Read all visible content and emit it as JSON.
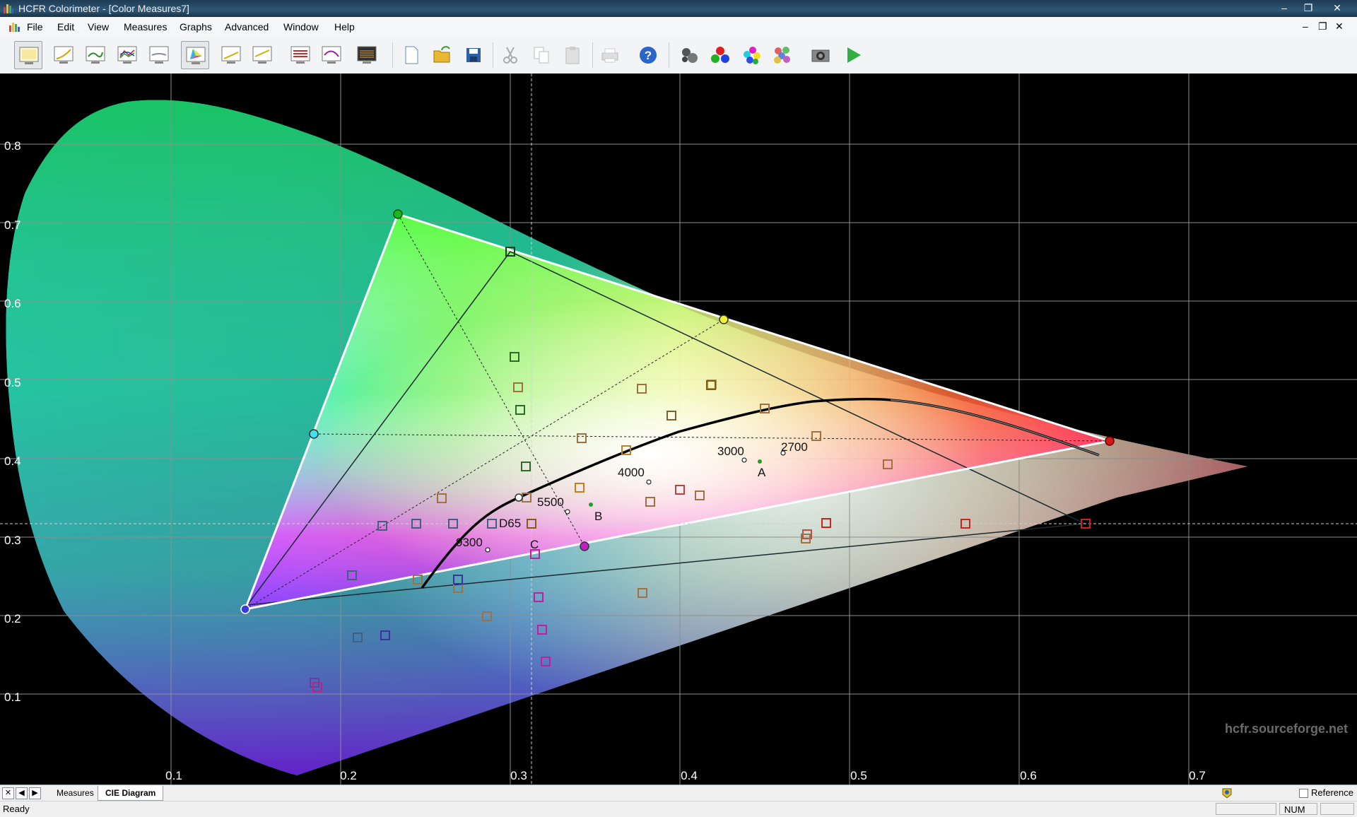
{
  "window": {
    "title": "HCFR Colorimeter - [Color Measures7]"
  },
  "menu": [
    "File",
    "Edit",
    "View",
    "Measures",
    "Graphs",
    "Advanced",
    "Window",
    "Help"
  ],
  "toolbar_icons": [
    "measures-view-icon",
    "gamma-graph-icon",
    "luminance-graph-icon",
    "rgb-levels-graph-icon",
    "color-temp-graph-icon",
    "cie-diagram-icon",
    "near-black-graph-icon",
    "near-white-graph-icon",
    "saturation-graph-icon",
    "saturation-shift-graph-icon",
    "measures-comparison-icon",
    "new-document-icon",
    "open-folder-icon",
    "save-icon",
    "cut-icon",
    "copy-icon",
    "paste-icon",
    "print-icon",
    "help-icon",
    "sensor-icon",
    "primaries-icon",
    "secondaries-icon",
    "color-checker-icon",
    "camera-icon",
    "run-sequence-icon"
  ],
  "axes": {
    "x_ticks": [
      "0.1",
      "0.2",
      "0.3",
      "0.4",
      "0.5",
      "0.6",
      "0.7"
    ],
    "y_ticks": [
      "0.1",
      "0.2",
      "0.3",
      "0.4",
      "0.5",
      "0.6",
      "0.7",
      "0.8"
    ]
  },
  "labels": {
    "cct": [
      "9300",
      "5500",
      "4000",
      "3000",
      "2700"
    ],
    "white_points": [
      "D65",
      "C",
      "B",
      "A"
    ],
    "watermark": "hcfr.sourceforge.net"
  },
  "tabs": {
    "measures": "Measures",
    "cie": "CIE Diagram"
  },
  "reference_label": "Reference",
  "status": {
    "text": "Ready",
    "num": "NUM"
  }
}
